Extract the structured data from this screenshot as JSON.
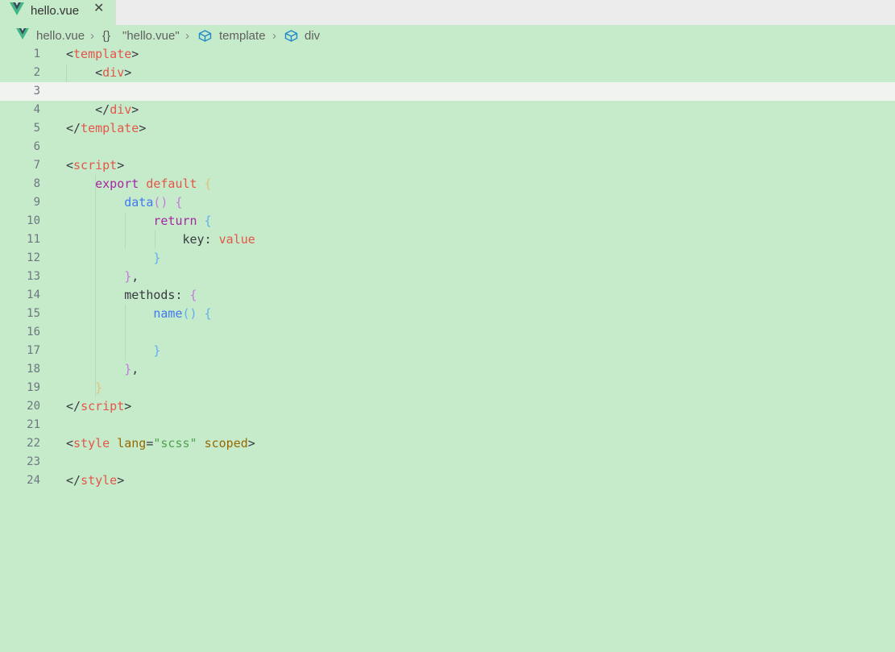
{
  "tab": {
    "title": "hello.vue",
    "close": "✕",
    "icon": "vue-logo-icon"
  },
  "breadcrumb": {
    "file": "hello.vue",
    "braces": "{}",
    "object": "\"hello.vue\"",
    "node1": "template",
    "node2": "div",
    "separator": "›"
  },
  "editor": {
    "current_line": 3,
    "line_numbers": [
      "1",
      "2",
      "3",
      "4",
      "5",
      "6",
      "7",
      "8",
      "9",
      "10",
      "11",
      "12",
      "13",
      "14",
      "15",
      "16",
      "17",
      "18",
      "19",
      "20",
      "21",
      "22",
      "23",
      "24"
    ],
    "tokens": {
      "lt": "<",
      "gt": ">",
      "close": "</",
      "template": "template",
      "div": "div",
      "script": "script",
      "style": "style",
      "export": "export",
      "default": "default",
      "open_brace": "{",
      "close_brace": "}",
      "data": "data",
      "parens": "()",
      "return": "return",
      "key": "key",
      "colon": ":",
      "value": "value",
      "close_brace_comma": "},",
      "comma": ",",
      "methods": "methods",
      "name": "name",
      "lang": "lang",
      "eq": "=",
      "scss": "\"scss\"",
      "scoped": "scoped"
    }
  },
  "colors": {
    "background": "#c6ebcb",
    "current_line": "#f1f3f1",
    "tag": "#e45649",
    "keyword": "#a626a4",
    "function": "#4078f2"
  }
}
